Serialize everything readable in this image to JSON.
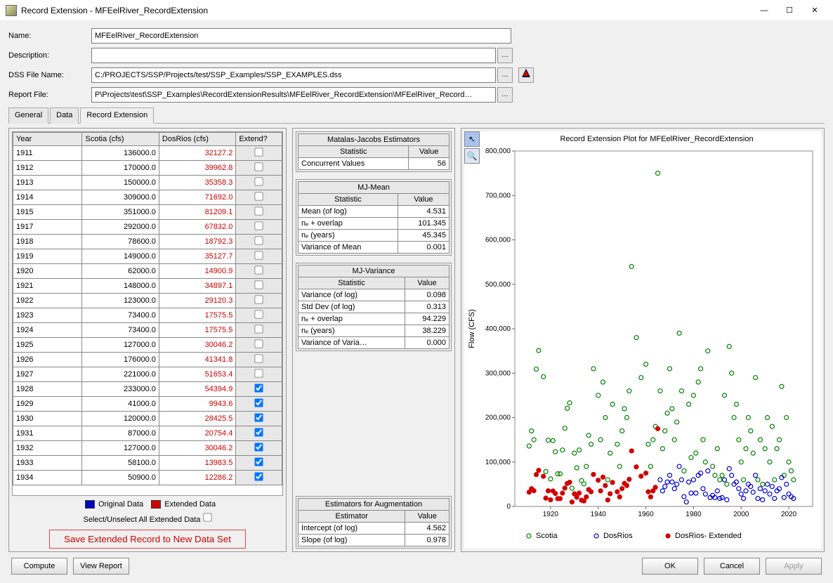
{
  "window": {
    "title": "Record Extension -  MFEelRiver_RecordExtension"
  },
  "form": {
    "name_label": "Name:",
    "name_value": "MFEelRiver_RecordExtension",
    "desc_label": "Description:",
    "desc_value": "",
    "dss_label": "DSS File Name:",
    "dss_value": "C:/PROJECTS/SSP/Projects/test/SSP_Examples/SSP_EXAMPLES.dss",
    "report_label": "Report File:",
    "report_value": "P\\Projects\\test\\SSP_Examples\\RecordExtensionResults\\MFEelRiver_RecordExtension\\MFEelRiver_Record…"
  },
  "tabs": {
    "general": "General",
    "data": "Data",
    "rec": "Record Extension"
  },
  "datatable": {
    "headers": {
      "year": "Year",
      "scotia": "Scotia (cfs)",
      "dosrios": "DosRios (cfs)",
      "extend": "Extend?"
    },
    "rows": [
      {
        "year": "1911",
        "scotia": "136000.0",
        "dosrios": "32127.2",
        "ext": false
      },
      {
        "year": "1912",
        "scotia": "170000.0",
        "dosrios": "39962.8",
        "ext": false
      },
      {
        "year": "1913",
        "scotia": "150000.0",
        "dosrios": "35358.3",
        "ext": false
      },
      {
        "year": "1914",
        "scotia": "309000.0",
        "dosrios": "71692.0",
        "ext": false
      },
      {
        "year": "1915",
        "scotia": "351000.0",
        "dosrios": "81209.1",
        "ext": false
      },
      {
        "year": "1917",
        "scotia": "292000.0",
        "dosrios": "67832.0",
        "ext": false
      },
      {
        "year": "1918",
        "scotia": "78600.0",
        "dosrios": "18792.3",
        "ext": false
      },
      {
        "year": "1919",
        "scotia": "149000.0",
        "dosrios": "35127.7",
        "ext": false
      },
      {
        "year": "1920",
        "scotia": "62000.0",
        "dosrios": "14900.9",
        "ext": false
      },
      {
        "year": "1921",
        "scotia": "148000.0",
        "dosrios": "34897.1",
        "ext": false
      },
      {
        "year": "1922",
        "scotia": "123000.0",
        "dosrios": "29120.3",
        "ext": false
      },
      {
        "year": "1923",
        "scotia": "73400.0",
        "dosrios": "17575.5",
        "ext": false
      },
      {
        "year": "1924",
        "scotia": "73400.0",
        "dosrios": "17575.5",
        "ext": false
      },
      {
        "year": "1925",
        "scotia": "127000.0",
        "dosrios": "30046.2",
        "ext": false
      },
      {
        "year": "1926",
        "scotia": "176000.0",
        "dosrios": "41341.8",
        "ext": false
      },
      {
        "year": "1927",
        "scotia": "221000.0",
        "dosrios": "51653.4",
        "ext": false
      },
      {
        "year": "1928",
        "scotia": "233000.0",
        "dosrios": "54394.9",
        "ext": true
      },
      {
        "year": "1929",
        "scotia": "41000.0",
        "dosrios": "9943.6",
        "ext": true
      },
      {
        "year": "1930",
        "scotia": "120000.0",
        "dosrios": "28425.5",
        "ext": true
      },
      {
        "year": "1931",
        "scotia": "87000.0",
        "dosrios": "20754.4",
        "ext": true
      },
      {
        "year": "1932",
        "scotia": "127000.0",
        "dosrios": "30046.2",
        "ext": true
      },
      {
        "year": "1933",
        "scotia": "58100.0",
        "dosrios": "13983.5",
        "ext": true
      },
      {
        "year": "1934",
        "scotia": "50900.0",
        "dosrios": "12286.2",
        "ext": true
      }
    ],
    "legend_original": "Original Data",
    "legend_extended": "Extended Data",
    "select_label": "Select/Unselect All Extended Data",
    "save_label": "Save Extended Record to New Data Set"
  },
  "stats": {
    "mj_title": "Matalas-Jacobs Estimators",
    "stat_h": "Statistic",
    "val_h": "Value",
    "conc_l": "Concurrent Values",
    "conc_v": "56",
    "mjmean_title": "MJ-Mean",
    "mean_l": "Mean (of log)",
    "mean_v": "4.531",
    "neo_l": "nₑ + overlap",
    "neo_v": "101.345",
    "ney_l": "nₑ (years)",
    "ney_v": "45.345",
    "vom_l": "Variance of Mean",
    "vom_v": "0.001",
    "mjvar_title": "MJ-Variance",
    "vol_l": "Variance (of log)",
    "vol_v": "0.098",
    "std_l": "Std Dev (of log)",
    "std_v": "0.313",
    "neov_l": "nₑ + overlap",
    "neov_v": "94.229",
    "neyv_l": "nₑ (years)",
    "neyv_v": "38.229",
    "vov_l": "Variance of Varia…",
    "vov_v": "0.000",
    "aug_title": "Estimators for Augmentation",
    "est_h": "Estimator",
    "int_l": "Intercept (of log)",
    "int_v": "4.562",
    "slp_l": "Slope (of log)",
    "slp_v": "0.978"
  },
  "chart": {
    "title": "Record Extension Plot for MFEelRiver_RecordExtension",
    "ylabel": "Flow (CFS)",
    "legend": {
      "scotia": "Scotia",
      "dosrios": "DosRios",
      "ext": "DosRios- Extended"
    }
  },
  "chart_data": {
    "type": "scatter",
    "xlabel": "",
    "ylabel": "Flow (CFS)",
    "xlim": [
      1905,
      2030
    ],
    "ylim": [
      0,
      800000
    ],
    "xticks": [
      1920,
      1940,
      1960,
      1980,
      2000,
      2020
    ],
    "yticks": [
      0,
      100000,
      200000,
      300000,
      400000,
      500000,
      600000,
      700000,
      800000
    ],
    "series": [
      {
        "name": "Scotia",
        "color": "#008000",
        "fill": "none",
        "points": [
          [
            1911,
            136000
          ],
          [
            1912,
            170000
          ],
          [
            1913,
            150000
          ],
          [
            1914,
            309000
          ],
          [
            1915,
            351000
          ],
          [
            1917,
            292000
          ],
          [
            1918,
            78600
          ],
          [
            1919,
            149000
          ],
          [
            1920,
            62000
          ],
          [
            1921,
            148000
          ],
          [
            1922,
            123000
          ],
          [
            1923,
            73400
          ],
          [
            1924,
            73400
          ],
          [
            1925,
            127000
          ],
          [
            1926,
            176000
          ],
          [
            1927,
            221000
          ],
          [
            1928,
            233000
          ],
          [
            1929,
            41000
          ],
          [
            1930,
            120000
          ],
          [
            1931,
            87000
          ],
          [
            1932,
            127000
          ],
          [
            1933,
            58100
          ],
          [
            1934,
            50900
          ],
          [
            1935,
            90000
          ],
          [
            1936,
            160000
          ],
          [
            1937,
            140000
          ],
          [
            1938,
            310000
          ],
          [
            1940,
            250000
          ],
          [
            1941,
            150000
          ],
          [
            1942,
            280000
          ],
          [
            1943,
            200000
          ],
          [
            1944,
            60000
          ],
          [
            1945,
            120000
          ],
          [
            1946,
            230000
          ],
          [
            1948,
            140000
          ],
          [
            1949,
            90000
          ],
          [
            1950,
            170000
          ],
          [
            1951,
            220000
          ],
          [
            1952,
            200000
          ],
          [
            1953,
            260000
          ],
          [
            1954,
            540000
          ],
          [
            1956,
            380000
          ],
          [
            1958,
            290000
          ],
          [
            1960,
            320000
          ],
          [
            1961,
            140000
          ],
          [
            1962,
            90000
          ],
          [
            1963,
            150000
          ],
          [
            1964,
            180000
          ],
          [
            1965,
            750000
          ],
          [
            1966,
            260000
          ],
          [
            1967,
            130000
          ],
          [
            1968,
            170000
          ],
          [
            1969,
            210000
          ],
          [
            1970,
            310000
          ],
          [
            1971,
            220000
          ],
          [
            1972,
            150000
          ],
          [
            1973,
            190000
          ],
          [
            1974,
            390000
          ],
          [
            1975,
            260000
          ],
          [
            1976,
            80000
          ],
          [
            1978,
            230000
          ],
          [
            1979,
            110000
          ],
          [
            1980,
            250000
          ],
          [
            1981,
            120000
          ],
          [
            1982,
            280000
          ],
          [
            1983,
            310000
          ],
          [
            1984,
            150000
          ],
          [
            1985,
            100000
          ],
          [
            1986,
            350000
          ],
          [
            1988,
            90000
          ],
          [
            1989,
            70000
          ],
          [
            1990,
            130000
          ],
          [
            1991,
            60000
          ],
          [
            1992,
            70000
          ],
          [
            1993,
            250000
          ],
          [
            1994,
            50000
          ],
          [
            1995,
            360000
          ],
          [
            1996,
            300000
          ],
          [
            1997,
            200000
          ],
          [
            1998,
            230000
          ],
          [
            1999,
            150000
          ],
          [
            2000,
            100000
          ],
          [
            2001,
            60000
          ],
          [
            2002,
            130000
          ],
          [
            2003,
            200000
          ],
          [
            2004,
            170000
          ],
          [
            2005,
            120000
          ],
          [
            2006,
            290000
          ],
          [
            2007,
            60000
          ],
          [
            2008,
            150000
          ],
          [
            2009,
            50000
          ],
          [
            2010,
            130000
          ],
          [
            2011,
            200000
          ],
          [
            2012,
            100000
          ],
          [
            2013,
            180000
          ],
          [
            2014,
            60000
          ],
          [
            2015,
            130000
          ],
          [
            2016,
            150000
          ],
          [
            2017,
            270000
          ],
          [
            2018,
            70000
          ],
          [
            2019,
            200000
          ],
          [
            2020,
            100000
          ],
          [
            2021,
            80000
          ],
          [
            2022,
            60000
          ]
        ]
      },
      {
        "name": "DosRios",
        "color": "#0000d0",
        "fill": "none",
        "points": [
          [
            1966,
            60000
          ],
          [
            1967,
            35000
          ],
          [
            1968,
            45000
          ],
          [
            1969,
            55000
          ],
          [
            1970,
            70000
          ],
          [
            1971,
            55000
          ],
          [
            1972,
            40000
          ],
          [
            1973,
            50000
          ],
          [
            1974,
            90000
          ],
          [
            1975,
            60000
          ],
          [
            1976,
            22000
          ],
          [
            1977,
            10000
          ],
          [
            1978,
            55000
          ],
          [
            1979,
            30000
          ],
          [
            1980,
            60000
          ],
          [
            1981,
            30000
          ],
          [
            1982,
            70000
          ],
          [
            1983,
            75000
          ],
          [
            1984,
            40000
          ],
          [
            1985,
            28000
          ],
          [
            1986,
            80000
          ],
          [
            1987,
            20000
          ],
          [
            1988,
            25000
          ],
          [
            1989,
            20000
          ],
          [
            1990,
            35000
          ],
          [
            1991,
            18000
          ],
          [
            1992,
            20000
          ],
          [
            1993,
            60000
          ],
          [
            1994,
            15000
          ],
          [
            1995,
            85000
          ],
          [
            1996,
            70000
          ],
          [
            1997,
            50000
          ],
          [
            1998,
            55000
          ],
          [
            1999,
            40000
          ],
          [
            2000,
            28000
          ],
          [
            2001,
            18000
          ],
          [
            2002,
            35000
          ],
          [
            2003,
            50000
          ],
          [
            2004,
            45000
          ],
          [
            2005,
            32000
          ],
          [
            2006,
            70000
          ],
          [
            2007,
            18000
          ],
          [
            2008,
            40000
          ],
          [
            2009,
            15000
          ],
          [
            2010,
            35000
          ],
          [
            2011,
            50000
          ],
          [
            2012,
            28000
          ],
          [
            2013,
            45000
          ],
          [
            2014,
            18000
          ],
          [
            2015,
            35000
          ],
          [
            2016,
            40000
          ],
          [
            2017,
            65000
          ],
          [
            2018,
            20000
          ],
          [
            2019,
            50000
          ],
          [
            2020,
            28000
          ],
          [
            2021,
            22000
          ],
          [
            2022,
            18000
          ]
        ]
      },
      {
        "name": "DosRios- Extended",
        "color": "#d00000",
        "fill": "#d00000",
        "points": [
          [
            1911,
            32127
          ],
          [
            1912,
            39963
          ],
          [
            1913,
            35358
          ],
          [
            1914,
            71692
          ],
          [
            1915,
            81209
          ],
          [
            1917,
            67832
          ],
          [
            1918,
            18792
          ],
          [
            1919,
            35128
          ],
          [
            1920,
            14901
          ],
          [
            1921,
            34897
          ],
          [
            1922,
            29120
          ],
          [
            1923,
            17576
          ],
          [
            1924,
            17576
          ],
          [
            1925,
            30046
          ],
          [
            1926,
            41342
          ],
          [
            1927,
            51653
          ],
          [
            1928,
            54395
          ],
          [
            1929,
            9944
          ],
          [
            1930,
            28426
          ],
          [
            1931,
            20754
          ],
          [
            1932,
            30046
          ],
          [
            1933,
            13984
          ],
          [
            1934,
            12286
          ],
          [
            1935,
            21500
          ],
          [
            1936,
            38000
          ],
          [
            1937,
            33000
          ],
          [
            1938,
            72000
          ],
          [
            1940,
            59000
          ],
          [
            1941,
            35000
          ],
          [
            1942,
            66000
          ],
          [
            1943,
            47000
          ],
          [
            1944,
            14500
          ],
          [
            1945,
            28500
          ],
          [
            1946,
            54000
          ],
          [
            1948,
            33000
          ],
          [
            1949,
            21500
          ],
          [
            1950,
            40000
          ],
          [
            1951,
            52000
          ],
          [
            1952,
            47000
          ],
          [
            1953,
            61000
          ],
          [
            1954,
            125000
          ],
          [
            1956,
            89000
          ],
          [
            1958,
            68000
          ],
          [
            1960,
            75000
          ],
          [
            1961,
            33000
          ],
          [
            1962,
            21500
          ],
          [
            1963,
            35000
          ],
          [
            1964,
            43000
          ],
          [
            1965,
            175000
          ]
        ]
      }
    ]
  },
  "buttons": {
    "compute": "Compute",
    "view": "View Report",
    "ok": "OK",
    "cancel": "Cancel",
    "apply": "Apply"
  }
}
